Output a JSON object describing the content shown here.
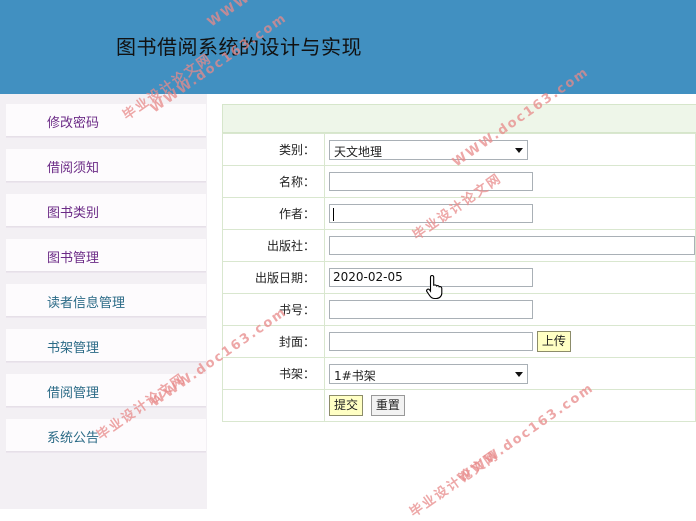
{
  "header": {
    "title": "图书借阅系统的设计与实现"
  },
  "sidebar": {
    "items": [
      {
        "label": "修改密码"
      },
      {
        "label": "借阅须知"
      },
      {
        "label": "图书类别"
      },
      {
        "label": "图书管理"
      },
      {
        "label": "读者信息管理"
      },
      {
        "label": "书架管理"
      },
      {
        "label": "借阅管理"
      },
      {
        "label": "系统公告"
      }
    ]
  },
  "form": {
    "category": {
      "label": "类别：",
      "value": "天文地理"
    },
    "name": {
      "label": "名称：",
      "value": ""
    },
    "author": {
      "label": "作者：",
      "value": ""
    },
    "publisher": {
      "label": "出版社：",
      "value": ""
    },
    "pub_date": {
      "label": "出版日期：",
      "value": "2020-02-05"
    },
    "book_no": {
      "label": "书号：",
      "value": ""
    },
    "cover": {
      "label": "封面：",
      "value": "",
      "upload_label": "上传"
    },
    "shelf": {
      "label": "书架：",
      "value": "1#书架"
    },
    "submit_label": "提交",
    "reset_label": "重置"
  },
  "watermarks": {
    "site": "WWW.doc163.com",
    "name": "毕业设计论文网"
  },
  "colors": {
    "header_bg": "#4190c1",
    "sidebar_bg": "#f3f0f4",
    "label_purple": "#6b2a86",
    "label_teal": "#2a6a86",
    "table_border": "#d9e7cf",
    "button_yellow": "#ffffc4",
    "watermark": "#e88a8a"
  },
  "icons": {
    "pointer": "hand-pointer-icon",
    "dropdown": "chevron-down-icon"
  }
}
